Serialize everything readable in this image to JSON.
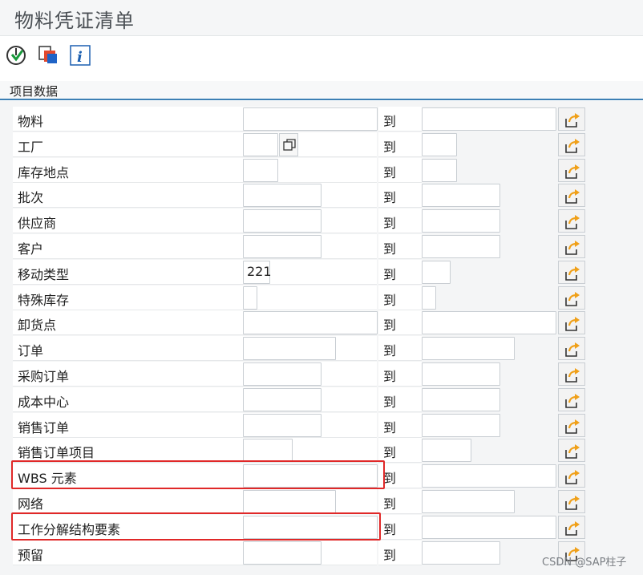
{
  "window": {
    "title": "物料凭证清单"
  },
  "toolbar": {
    "items": [
      {
        "icon": "execute-icon"
      },
      {
        "icon": "copy-variant-icon"
      },
      {
        "icon": "info-icon"
      }
    ]
  },
  "section": {
    "title": "项目数据"
  },
  "to_label": "到",
  "fields": [
    {
      "label": "物料",
      "value": ""
    },
    {
      "label": "工厂",
      "value": ""
    },
    {
      "label": "库存地点",
      "value": ""
    },
    {
      "label": "批次",
      "value": ""
    },
    {
      "label": "供应商",
      "value": ""
    },
    {
      "label": "客户",
      "value": ""
    },
    {
      "label": "移动类型",
      "value": "221"
    },
    {
      "label": "特殊库存",
      "value": ""
    },
    {
      "label": "卸货点",
      "value": ""
    },
    {
      "label": "订单",
      "value": ""
    },
    {
      "label": "采购订单",
      "value": ""
    },
    {
      "label": "成本中心",
      "value": ""
    },
    {
      "label": "销售订单",
      "value": ""
    },
    {
      "label": "销售订单项目",
      "value": ""
    },
    {
      "label": "WBS 元素",
      "value": ""
    },
    {
      "label": "网络",
      "value": ""
    },
    {
      "label": "工作分解结构要素",
      "value": ""
    },
    {
      "label": "预留",
      "value": ""
    }
  ],
  "highlight_color": "#e02828",
  "watermark": "CSDN @SAP柱子"
}
